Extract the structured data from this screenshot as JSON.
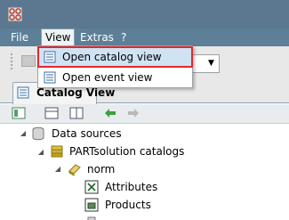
{
  "menubar": {
    "items": [
      {
        "label": "File"
      },
      {
        "label": "View"
      },
      {
        "label": "Extras"
      },
      {
        "label": "?"
      }
    ]
  },
  "view_menu": {
    "items": [
      {
        "label": "Open catalog view"
      },
      {
        "label": "Open event view"
      }
    ]
  },
  "tabs": [
    {
      "label": "Catalog View"
    }
  ],
  "tree": {
    "nodes": [
      {
        "label": "Data sources"
      },
      {
        "label": "PARTsolution catalogs"
      },
      {
        "label": "norm"
      },
      {
        "label": "Attributes"
      },
      {
        "label": "Products"
      }
    ]
  },
  "colors": {
    "title_bar": "#5b7890",
    "menu_bar": "#5d7f97",
    "highlight_border": "#e0282e",
    "selected_item_bg": "#cfe3f3"
  }
}
